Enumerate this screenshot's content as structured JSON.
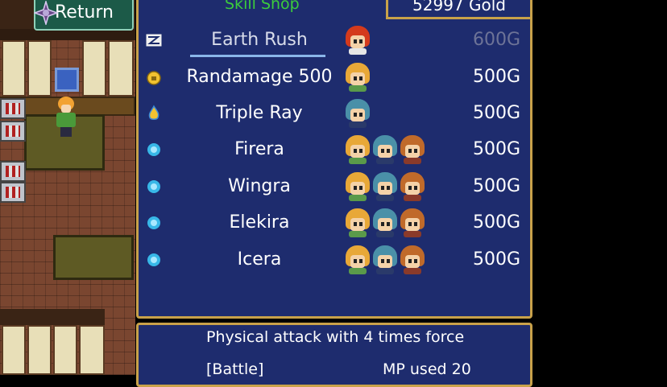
{
  "return_button": {
    "label": "Return",
    "icon": "compass-star-icon"
  },
  "shop": {
    "title": "Skill Shop",
    "gold": "52997 Gold",
    "items": [
      {
        "name": "Earth Rush",
        "icon": "skill-scroll-icon",
        "users": [
          "red"
        ],
        "price": "600G",
        "affordable": false,
        "selected": true
      },
      {
        "name": "Randamage 500",
        "icon": "coin-icon",
        "users": [
          "blond"
        ],
        "price": "500G",
        "affordable": true
      },
      {
        "name": "Triple Ray",
        "icon": "flame-icon",
        "users": [
          "teal"
        ],
        "price": "500G",
        "affordable": true
      },
      {
        "name": "Firera",
        "icon": "crystal-icon",
        "users": [
          "blond",
          "teal",
          "brown"
        ],
        "price": "500G",
        "affordable": true
      },
      {
        "name": "Wingra",
        "icon": "crystal-icon",
        "users": [
          "blond",
          "teal",
          "brown"
        ],
        "price": "500G",
        "affordable": true
      },
      {
        "name": "Elekira",
        "icon": "crystal-icon",
        "users": [
          "blond",
          "teal",
          "brown"
        ],
        "price": "500G",
        "affordable": true
      },
      {
        "name": "Icera",
        "icon": "crystal-icon",
        "users": [
          "blond",
          "teal",
          "brown"
        ],
        "price": "500G",
        "affordable": true
      }
    ]
  },
  "description": {
    "text": "Physical attack with 4 times force",
    "type": "[Battle]",
    "mp": "MP used 20"
  },
  "colors": {
    "window_bg": "#1e2c6e",
    "window_border": "#c9a24a",
    "title_green": "#3ccc3c",
    "disabled_price": "#6d7397"
  }
}
